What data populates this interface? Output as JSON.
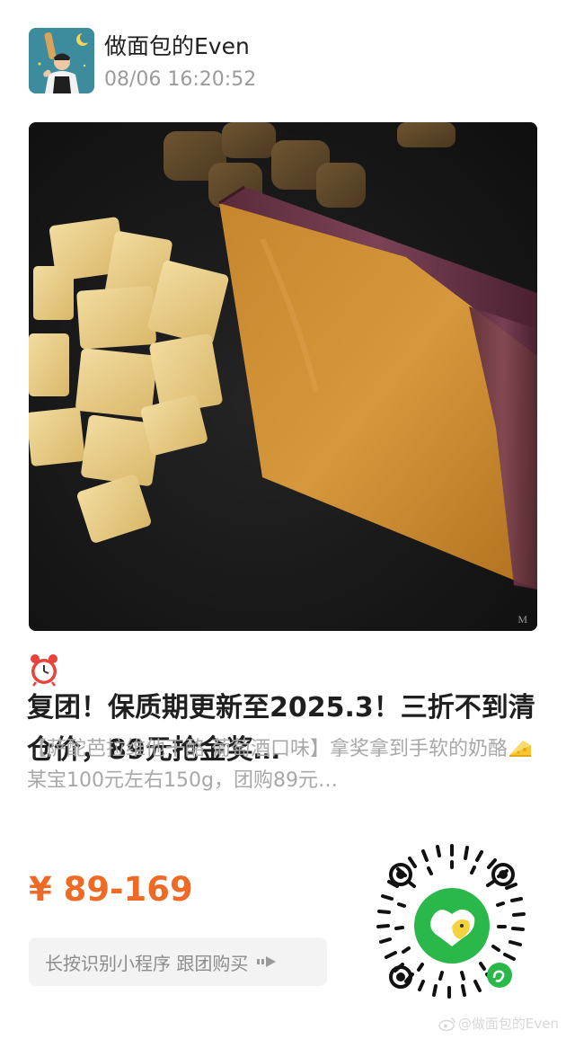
{
  "header": {
    "author_name": "做面包的Even",
    "post_time": "08/06 16:20:52",
    "avatar_icon": "baker-avatar"
  },
  "product": {
    "photo_icon": "cheese-photo",
    "title_icon": "alarm-clock-icon",
    "title": "复团！保质期更新至2025.3！三折不到清仓价，89元抢金奖…",
    "description_before": "【萨酡芭拉维他干酪 葡萄酒口味】拿奖拿到手软的奶酪",
    "description_icon": "cheese-emoji-icon",
    "description_after": "某宝100元左右150g，团购89元…",
    "price": "¥ 89-169",
    "price_color": "#ef6a24"
  },
  "action": {
    "button_label": "长按识别小程序 跟团购买",
    "button_icon": "arrow-right-icon"
  },
  "qr": {
    "icon": "mini-program-qr-code",
    "logo_color": "#2bb84a"
  },
  "watermark": {
    "icon": "weibo-icon",
    "text": "@做面包的Even"
  }
}
